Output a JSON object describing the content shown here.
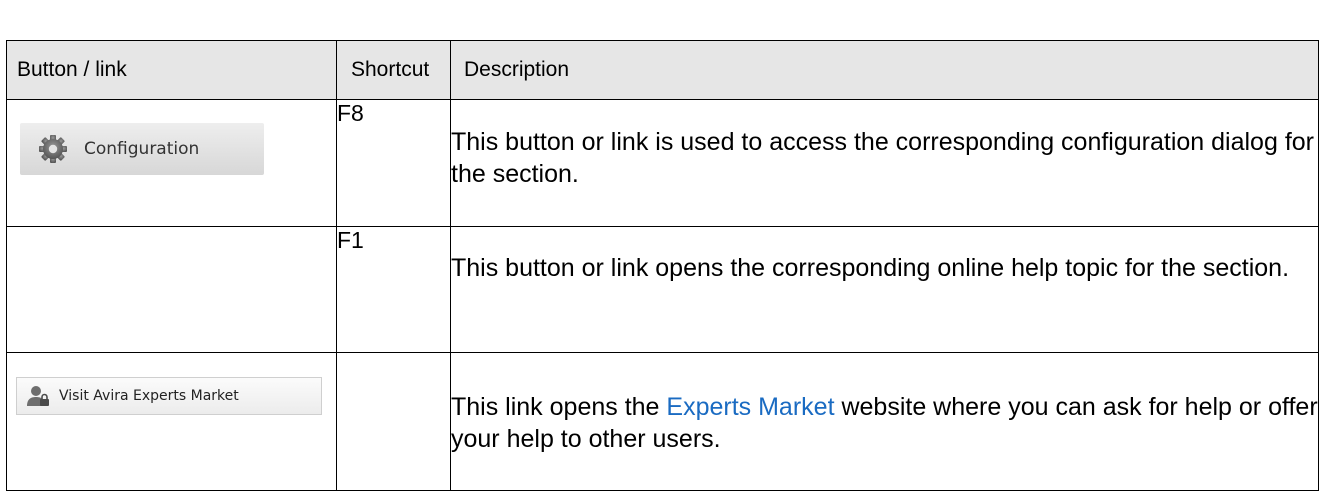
{
  "table": {
    "headers": {
      "button": "Button / link",
      "shortcut": "Shortcut",
      "description": "Description"
    },
    "rows": [
      {
        "button_label": "Configuration",
        "button_icon": "gear-icon",
        "shortcut": "F8",
        "description": "This button or link is used to access the corresponding configuration dialog for the section."
      },
      {
        "button_label": "",
        "shortcut": "F1",
        "description": "This button or link opens the corresponding online help topic for the section."
      },
      {
        "button_label": "Visit Avira Experts Market",
        "button_icon": "user-icon",
        "shortcut": "",
        "description_before": "This link opens the ",
        "description_link": "Experts Market",
        "description_after": " website where you can ask for help or offer your help to other users."
      }
    ]
  },
  "colors": {
    "header_bg": "#e6e6e6",
    "link": "#1a6bc2"
  }
}
